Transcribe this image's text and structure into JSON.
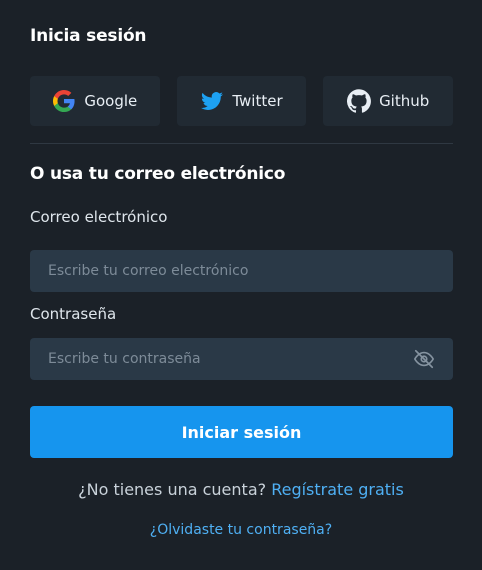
{
  "header": {
    "title": "Inicia sesión"
  },
  "social": {
    "google_label": "Google",
    "twitter_label": "Twitter",
    "github_label": "Github"
  },
  "section": {
    "subtitle": "O usa tu correo electrónico"
  },
  "form": {
    "email_label": "Correo electrónico",
    "email_placeholder": "Escribe tu correo electrónico",
    "email_value": "",
    "password_label": "Contraseña",
    "password_placeholder": "Escribe tu contraseña",
    "password_value": "",
    "submit_label": "Iniciar sesión"
  },
  "footer": {
    "no_account_text": "¿No tienes una cuenta?",
    "signup_link": "Regístrate gratis",
    "forgot_link": "¿Olvidaste tu contraseña?"
  },
  "icons": {
    "google": "google-logo-icon",
    "twitter": "twitter-bird-icon",
    "github": "github-octocat-icon",
    "password_toggle": "eye-slash-icon"
  },
  "colors": {
    "background": "#1b2128",
    "social_button": "#212a33",
    "input_background": "#2a3947",
    "primary": "#1695ee",
    "link": "#4fb0f4",
    "twitter": "#1da1f2"
  }
}
